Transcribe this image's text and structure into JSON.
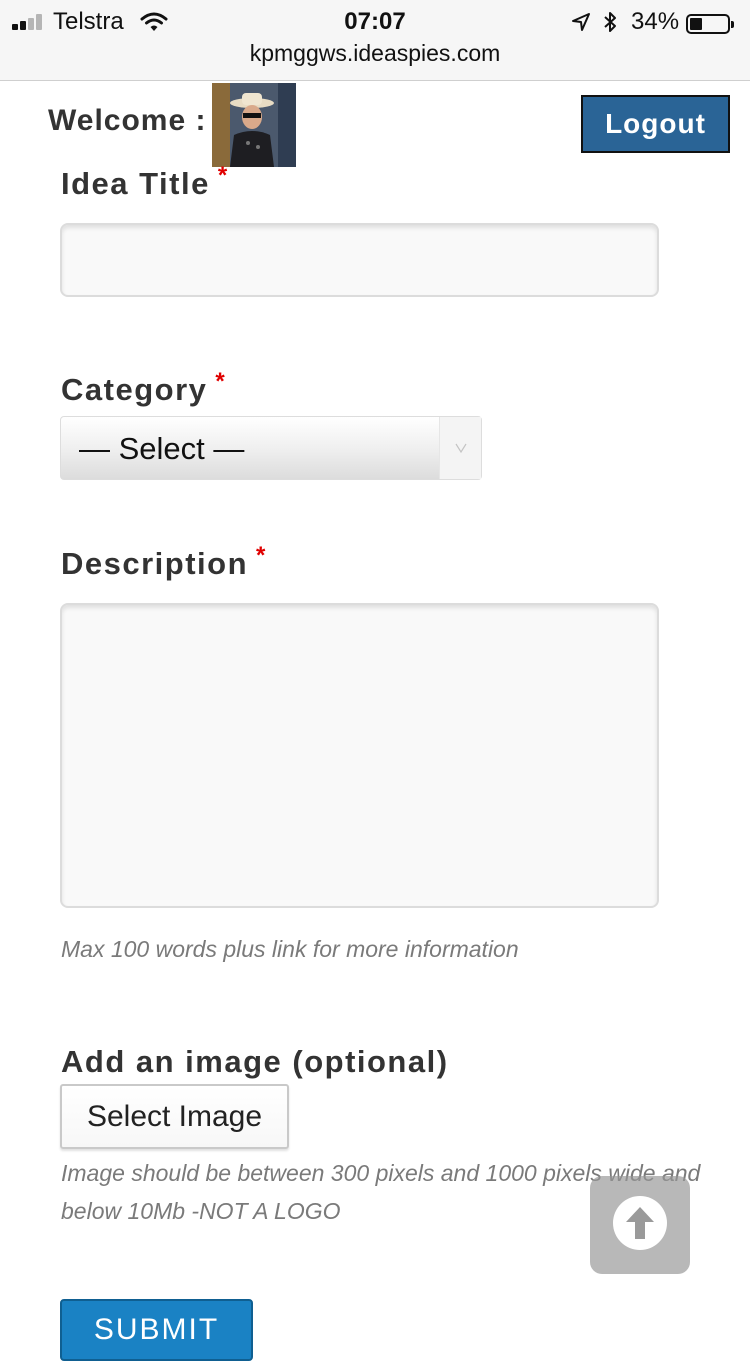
{
  "status_bar": {
    "carrier": "Telstra",
    "time": "07:07",
    "battery": "34%",
    "battery_level": 0.34,
    "url": "kpmggws.ideaspies.com",
    "icons": [
      "signal-icon",
      "wifi-icon",
      "location-arrow-icon",
      "bluetooth-icon",
      "battery-icon"
    ]
  },
  "header": {
    "welcome_label": "Welcome :",
    "logout_label": "Logout",
    "avatar": "user-avatar-photo"
  },
  "form": {
    "idea_title": {
      "label": "Idea Title",
      "required_marker": "*",
      "value": ""
    },
    "category": {
      "label": "Category",
      "required_marker": "*",
      "selected": "— Select —",
      "arrow_icon": "chevron-down-icon"
    },
    "description": {
      "label": "Description",
      "required_marker": "*",
      "value": "",
      "help": "Max 100 words plus link for more information"
    },
    "image": {
      "label": "Add an image (optional)",
      "button_label": "Select Image",
      "help": "Image should be between 300 pixels and 1000 pixels wide and below 10Mb -NOT A LOGO"
    },
    "submit_label": "SUBMIT"
  },
  "scroll_top": {
    "icon": "arrow-up-circle-icon"
  },
  "colors": {
    "logout_bg": "#2a6496",
    "submit_bg": "#1a82c4",
    "required": "#e00000",
    "label_text": "#333333",
    "help_text": "#7a7a7a"
  }
}
